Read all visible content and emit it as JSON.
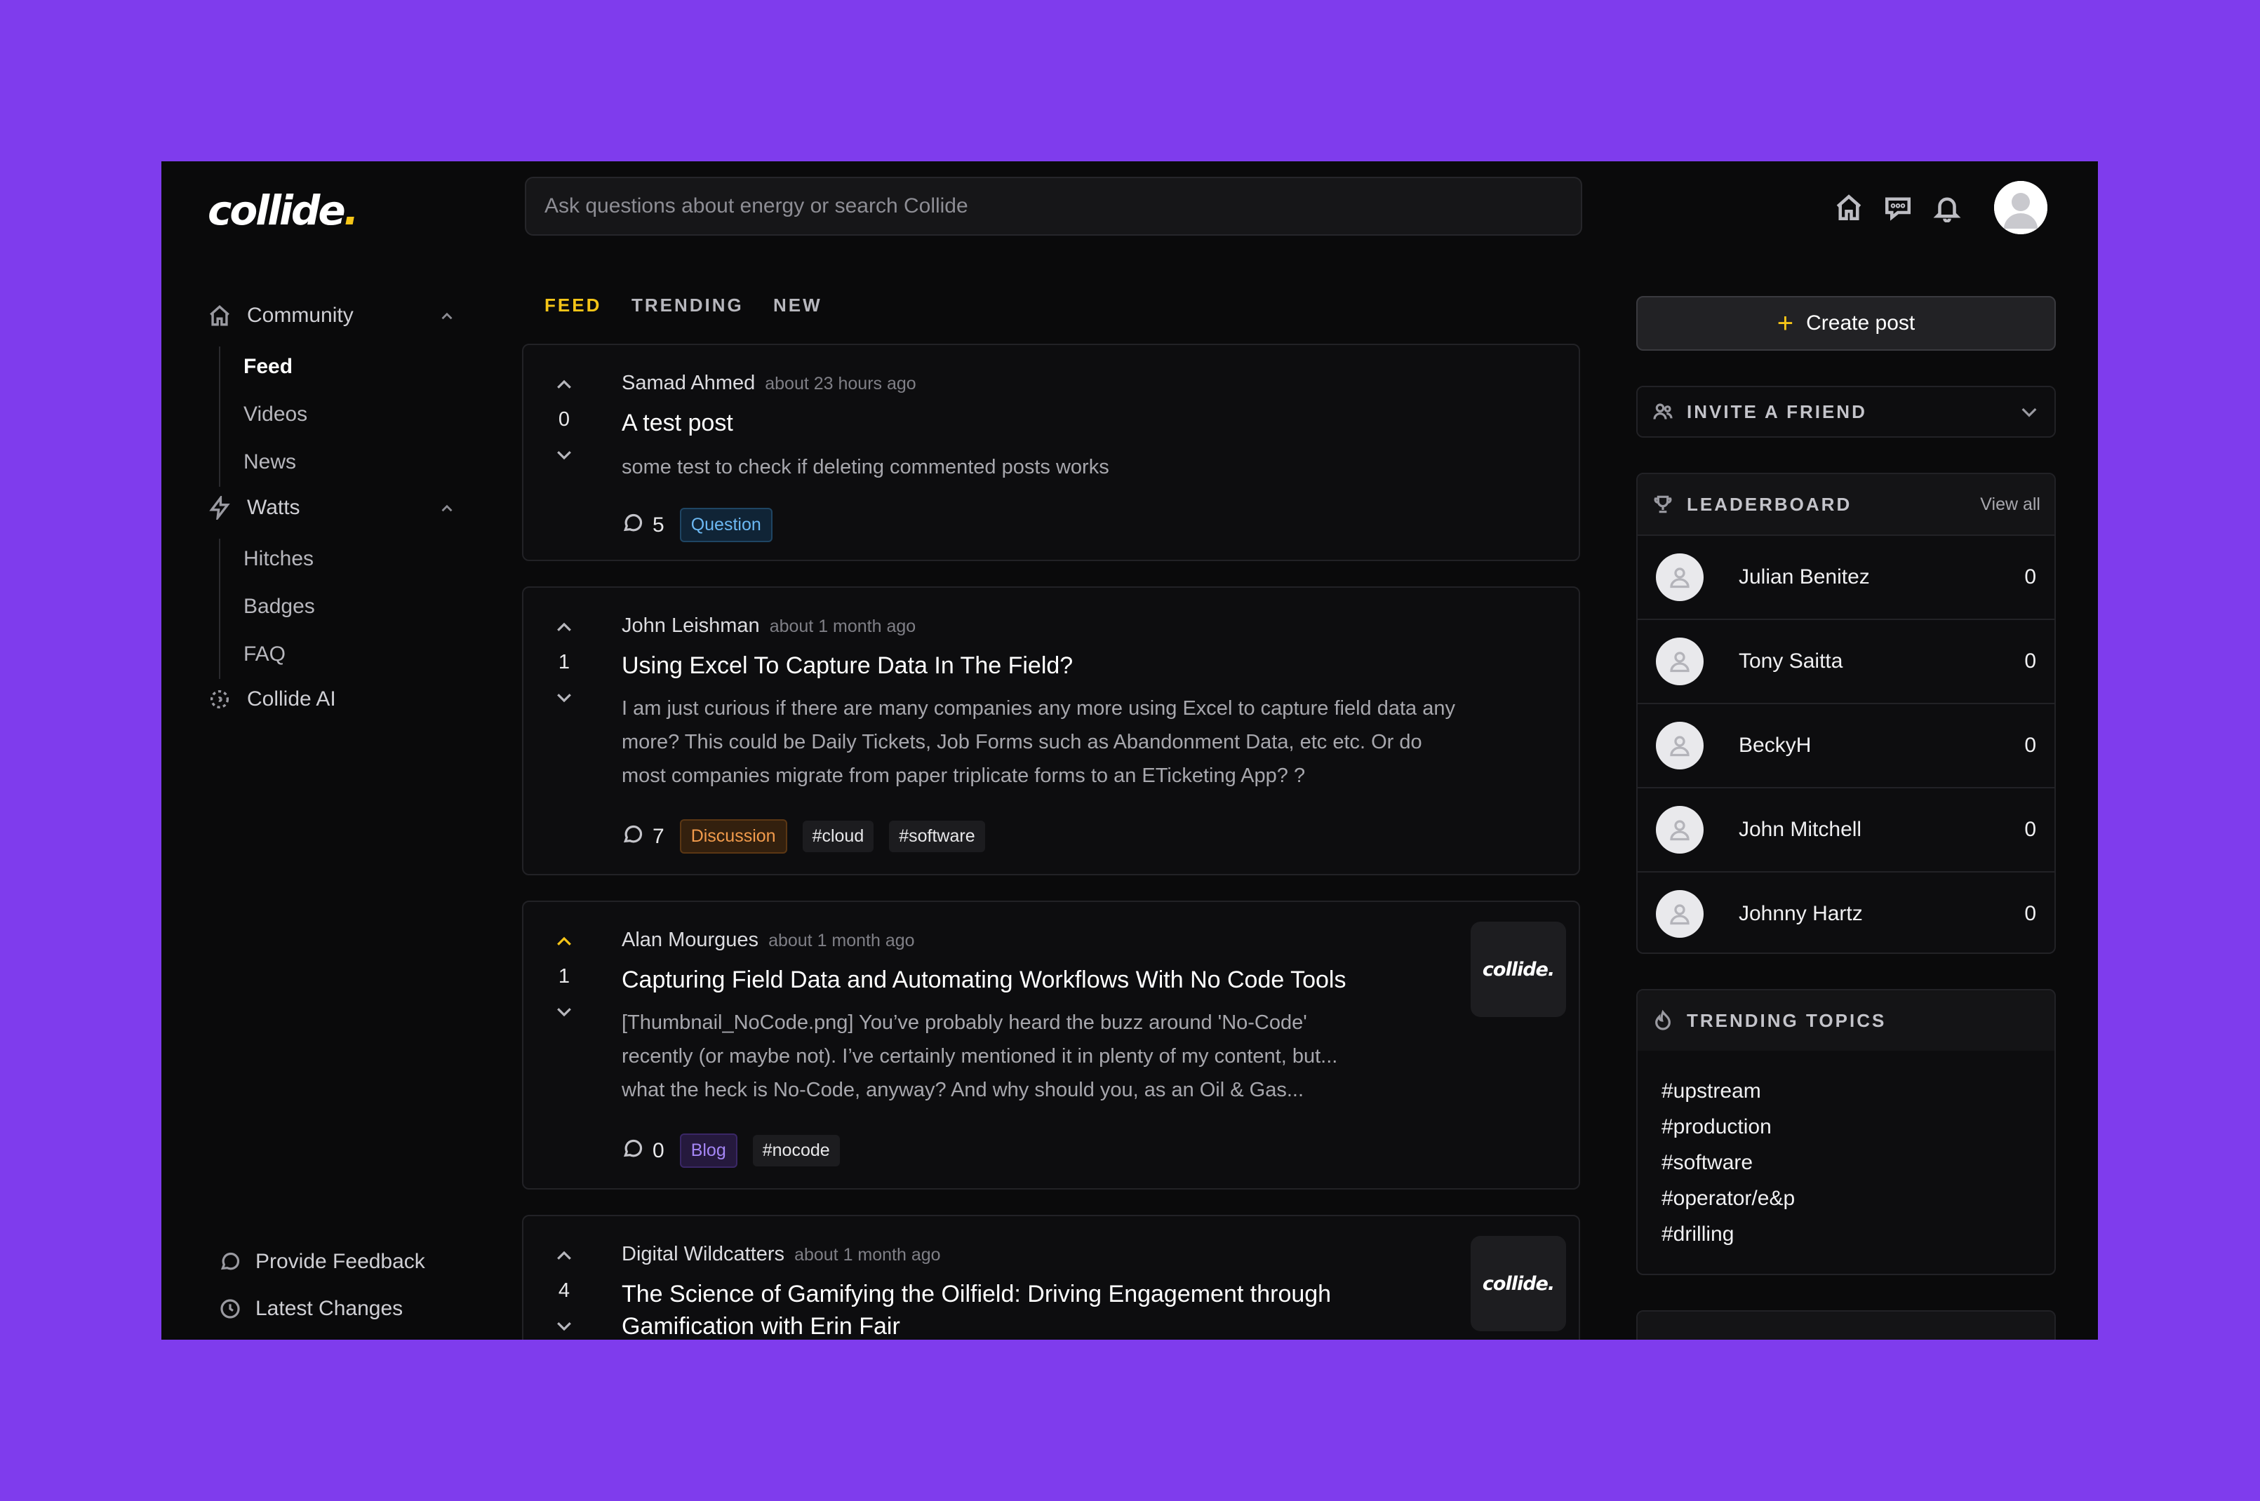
{
  "app": {
    "logo_text": "collide",
    "logo_dot": ".",
    "accent_color": "#f5c518",
    "background_color": "#7f3ced"
  },
  "search": {
    "placeholder": "Ask questions about energy or search Collide"
  },
  "top_icons": [
    "home-icon",
    "chat-icon",
    "bell-icon",
    "avatar"
  ],
  "sidebar": {
    "community": {
      "label": "Community",
      "items": [
        "Feed",
        "Videos",
        "News"
      ],
      "active": "Feed"
    },
    "watts": {
      "label": "Watts",
      "items": [
        "Hitches",
        "Badges",
        "FAQ"
      ]
    },
    "collide_ai": "Collide AI",
    "feedback": "Provide Feedback",
    "changes": "Latest Changes"
  },
  "tabs": [
    "FEED",
    "TRENDING",
    "NEW"
  ],
  "posts": [
    {
      "author": "Samad Ahmed",
      "time": "about 23 hours ago",
      "votes": "0",
      "title": "A test post",
      "body": "some test to check if deleting commented posts works",
      "comments": "5",
      "tags": [
        "Question"
      ]
    },
    {
      "author": "John Leishman",
      "time": "about 1 month ago",
      "votes": "1",
      "title": "Using Excel To Capture Data In The Field?",
      "body_lines": [
        "I am just curious if there are many companies any more using Excel to capture field data any",
        "more? This could be Daily Tickets, Job Forms such as Abandonment Data, etc etc.  Or do",
        "most companies migrate from paper triplicate forms to an ETicketing App? ?"
      ],
      "comments": "7",
      "tags": [
        "Discussion",
        "#cloud",
        "#software"
      ]
    },
    {
      "author": "Alan Mourgues",
      "time": "about 1 month ago",
      "votes": "1",
      "title": "Capturing Field Data and Automating Workflows With No Code Tools",
      "body_lines": [
        "[Thumbnail_NoCode.png] You’ve probably heard the buzz around 'No-Code'",
        "recently (or maybe not). I’ve certainly mentioned it in plenty of my content, but...",
        "what the heck is No-Code, anyway?  And why should you, as an Oil & Gas..."
      ],
      "comments": "0",
      "tags": [
        "Blog",
        "#nocode"
      ],
      "thumbnail_text": "collide."
    },
    {
      "author": "Digital Wildcatters",
      "time": "about 1 month ago",
      "votes": "4",
      "title_lines": [
        "The Science of Gamifying the Oilfield: Driving Engagement through",
        "Gamification with Erin Fair"
      ],
      "thumbnail_text": "collide."
    }
  ],
  "right": {
    "create_post": "Create post",
    "invite": "INVITE A FRIEND",
    "leaderboard": {
      "title": "LEADERBOARD",
      "view_all": "View all",
      "rows": [
        {
          "name": "Julian Benitez",
          "score": "0"
        },
        {
          "name": "Tony Saitta",
          "score": "0"
        },
        {
          "name": "BeckyH",
          "score": "0"
        },
        {
          "name": "John Mitchell",
          "score": "0"
        },
        {
          "name": "Johnny Hartz",
          "score": "0"
        }
      ]
    },
    "trending": {
      "title": "TRENDING TOPICS",
      "topics": [
        "#upstream",
        "#production",
        "#software",
        "#operator/e&p",
        "#drilling"
      ]
    }
  }
}
